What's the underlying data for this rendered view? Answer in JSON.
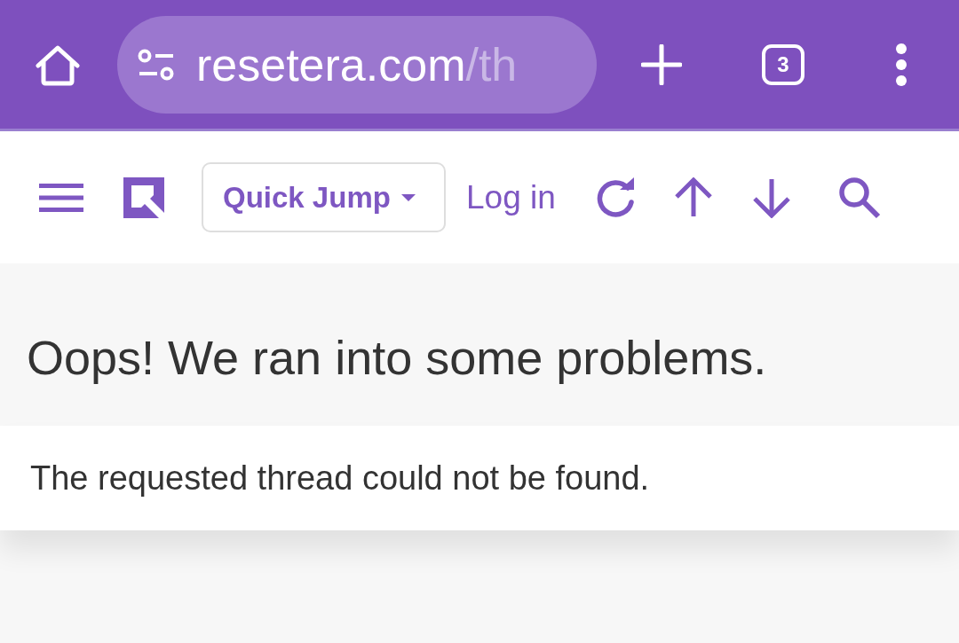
{
  "browser_toolbar": {
    "url_domain": "resetera.com",
    "url_path": "/th",
    "tab_count": "3"
  },
  "site_header": {
    "quick_jump": "Quick Jump",
    "login": "Log in"
  },
  "error": {
    "title": "Oops! We ran into some problems.",
    "message": "The requested thread could not be found."
  }
}
